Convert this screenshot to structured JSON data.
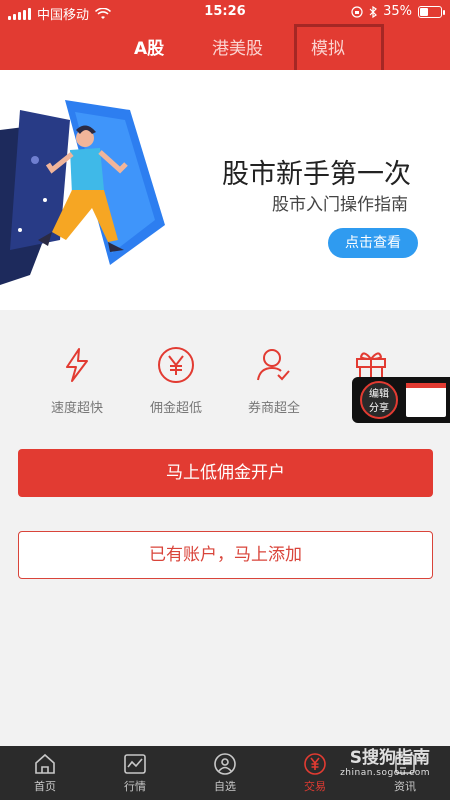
{
  "status_bar": {
    "carrier": "中国移动",
    "time": "15:26",
    "battery_percent": "35%",
    "battery_level": 0.35,
    "icons": [
      "signal-icon",
      "wifi-icon",
      "lock-rotation-icon",
      "bluetooth-icon",
      "battery-icon"
    ]
  },
  "tabs": [
    {
      "label": "A股",
      "active": true
    },
    {
      "label": "港美股",
      "active": false
    },
    {
      "label": "模拟",
      "active": false,
      "highlighted": true
    }
  ],
  "banner": {
    "title": "股市新手第一次",
    "subtitle": "股市入门操作指南",
    "button_label": "点击查看"
  },
  "features": [
    {
      "label": "速度超快",
      "icon": "lightning-icon"
    },
    {
      "label": "佣金超低",
      "icon": "yen-icon"
    },
    {
      "label": "券商超全",
      "icon": "person-check-icon"
    },
    {
      "label": "",
      "icon": "gift-icon"
    }
  ],
  "share_widget": {
    "label_line1": "编辑",
    "label_line2": "分享"
  },
  "buttons": {
    "open_account": "马上低佣金开户",
    "add_account": "已有账户，马上添加"
  },
  "bottom_nav": [
    {
      "label": "首页",
      "icon": "home-icon",
      "active": false
    },
    {
      "label": "行情",
      "icon": "chart-icon",
      "active": false
    },
    {
      "label": "自选",
      "icon": "watchlist-icon",
      "active": false
    },
    {
      "label": "交易",
      "icon": "trade-icon",
      "active": true
    },
    {
      "label": "资讯",
      "icon": "news-icon",
      "active": false
    }
  ],
  "watermark": {
    "main": "S搜狗指南",
    "sub": "zhinan.sogou.com"
  },
  "colors": {
    "brand_red": "#e23b32",
    "banner_button_blue": "#2f9bf0",
    "nav_bg": "#2b2b2b"
  }
}
